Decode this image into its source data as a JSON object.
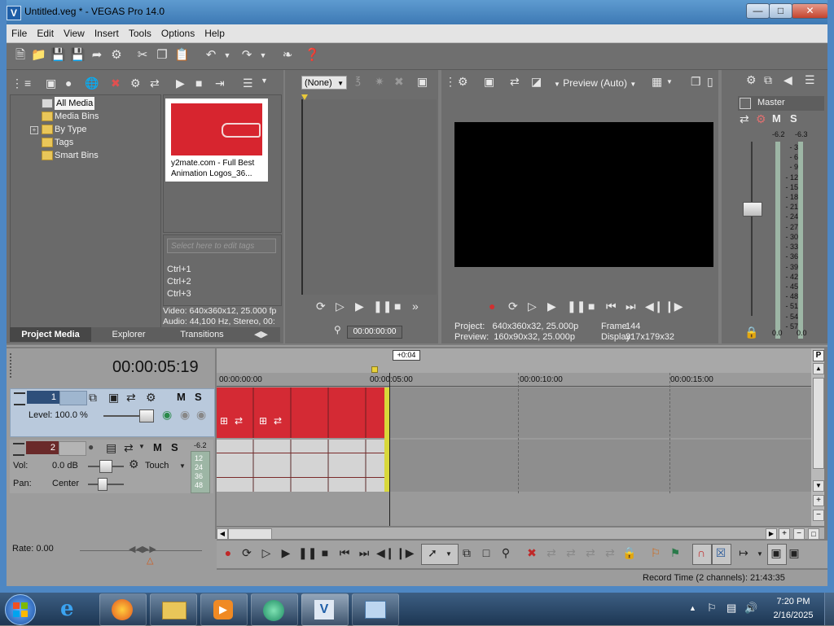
{
  "window": {
    "title": "Untitled.veg * - VEGAS Pro 14.0",
    "app_icon": "V"
  },
  "menu": [
    "File",
    "Edit",
    "View",
    "Insert",
    "Tools",
    "Options",
    "Help"
  ],
  "project_media": {
    "tree": [
      "All Media",
      "Media Bins",
      "By Type",
      "Tags",
      "Smart Bins"
    ],
    "thumb_caption_1": "y2mate.com - Full Best",
    "thumb_caption_2": "Animation Logos_36...",
    "tags_placeholder": "Select here to edit tags",
    "shortcuts": [
      "Ctrl+1",
      "Ctrl+2",
      "Ctrl+3"
    ],
    "info_video": "Video: 640x360x12, 25.000 fp",
    "info_audio": "Audio: 44,100 Hz, Stereo, 00:",
    "tabs": [
      "Project Media",
      "Explorer",
      "Transitions"
    ]
  },
  "trimmer": {
    "preset": "(None)",
    "timecode": "00:00:00:00"
  },
  "preview": {
    "mode": "Preview (Auto)",
    "project": "Project:   640x360x32, 25.000p",
    "frame_label": "Frame:",
    "frame": "144",
    "preview_info": "Preview:  160x90x32, 25.000p",
    "display_label": "Display:",
    "display": "317x179x32"
  },
  "master": {
    "label": "Master",
    "peak_left": "-6.2",
    "peak_right": "-6.3",
    "scale": [
      "3",
      "6",
      "9",
      "12",
      "15",
      "18",
      "21",
      "24",
      "27",
      "30",
      "33",
      "36",
      "39",
      "42",
      "45",
      "48",
      "51",
      "54",
      "57"
    ],
    "bottom_left": "0.0",
    "bottom_right": "0.0"
  },
  "timeline": {
    "time": "00:00:05:19",
    "cursor_offset": "+0:04",
    "ruler": [
      "00:00:00:00",
      "00:00:05:00",
      "00:00:10:00",
      "00:00:15:00"
    ],
    "video_track": {
      "number": "1",
      "level": "Level: 100.0 %"
    },
    "audio_track": {
      "number": "2",
      "peak": "-6.2",
      "vol_label": "Vol:",
      "vol": "0.0 dB",
      "pan_label": "Pan:",
      "pan": "Center",
      "mode": "Touch",
      "meter": [
        "12",
        "24",
        "36",
        "48"
      ]
    },
    "rate": "Rate: 0.00",
    "status": "Record Time (2 channels): 21:43:35"
  },
  "taskbar": {
    "time": "7:20 PM",
    "date": "2/16/2025"
  }
}
